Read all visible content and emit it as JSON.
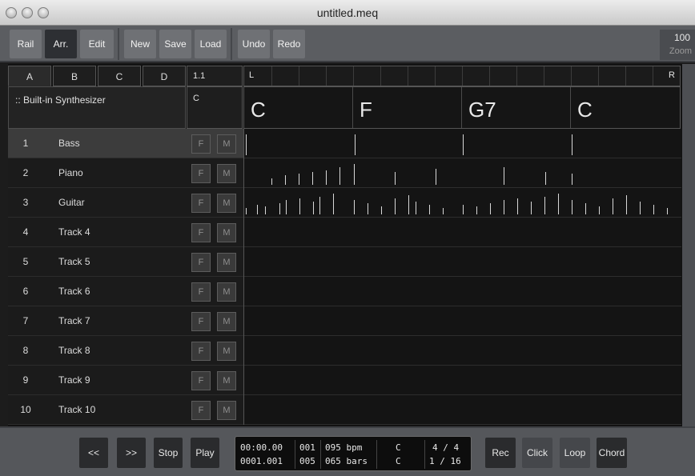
{
  "window": {
    "title": "untitled.meq"
  },
  "toolbar": {
    "view_buttons": [
      "Rail",
      "Arr.",
      "Edit"
    ],
    "active_view": "Arr.",
    "file_buttons": [
      "New",
      "Save",
      "Load"
    ],
    "edit_buttons": [
      "Undo",
      "Redo"
    ],
    "zoom_value": "100",
    "zoom_label": "Zoom"
  },
  "pattern_tabs": [
    "A",
    "B",
    "C",
    "D"
  ],
  "selected_tab": "A",
  "synth_label": ":: Built-in Synthesizer",
  "position": "1.1",
  "key": "C",
  "ruler": {
    "left_marker": "L",
    "right_marker": "R"
  },
  "chords": [
    "C",
    "F",
    "G7",
    "C"
  ],
  "tracks": [
    {
      "num": "1",
      "name": "Bass"
    },
    {
      "num": "2",
      "name": "Piano"
    },
    {
      "num": "3",
      "name": "Guitar"
    },
    {
      "num": "4",
      "name": "Track 4"
    },
    {
      "num": "5",
      "name": "Track 5"
    },
    {
      "num": "6",
      "name": "Track 6"
    },
    {
      "num": "7",
      "name": "Track 7"
    },
    {
      "num": "8",
      "name": "Track 8"
    },
    {
      "num": "9",
      "name": "Track 9"
    },
    {
      "num": "10",
      "name": "Track 10"
    }
  ],
  "track_buttons": {
    "freeze": "F",
    "mute": "M"
  },
  "transport": {
    "rewind": "<<",
    "forward": ">>",
    "stop": "Stop",
    "play": "Play",
    "time": "00:00.00",
    "bar": "001",
    "tempo": "095 bpm",
    "position": "0001.001",
    "beat": "005",
    "length": "065 bars",
    "key_top": "C",
    "key_bottom": "C",
    "meter": "4 / 4",
    "quantize": "1 / 16",
    "rec": "Rec",
    "click": "Click",
    "loop": "Loop",
    "chord": "Chord"
  }
}
